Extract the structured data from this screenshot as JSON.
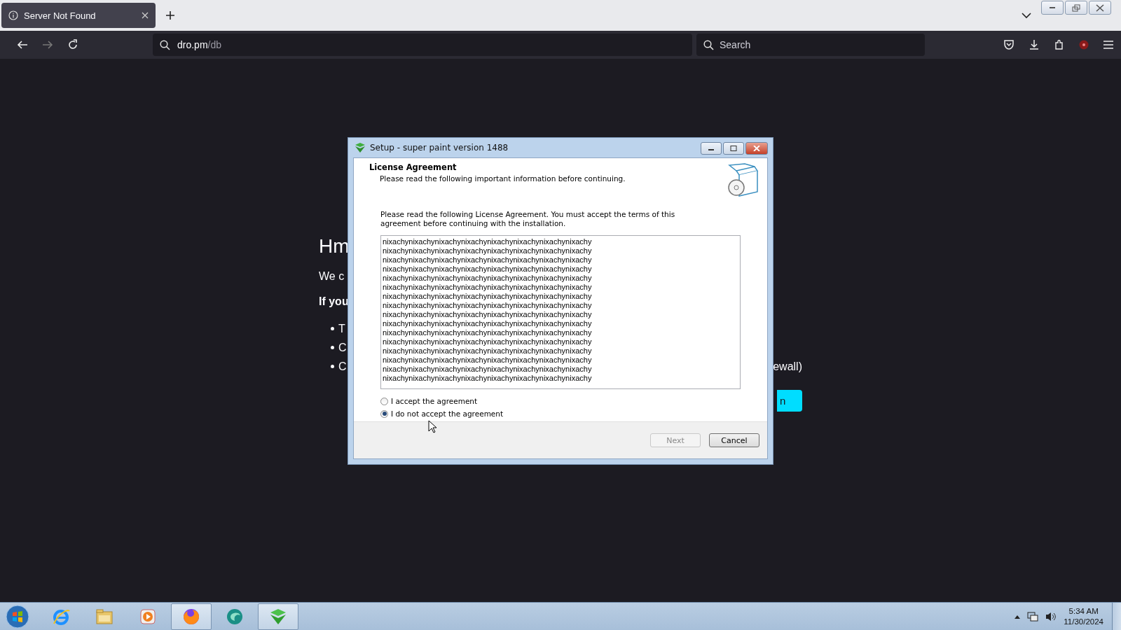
{
  "browser": {
    "tabs": [
      {
        "title": "Server Not Found",
        "selected": true
      }
    ],
    "nav": [
      {
        "kind": "back",
        "disabled": false
      },
      {
        "kind": "forward",
        "disabled": true
      },
      {
        "kind": "reload",
        "disabled": false
      }
    ],
    "url": {
      "host": "dro.pm",
      "path": "/db"
    },
    "search": {
      "placeholder": "Search"
    }
  },
  "page": {
    "heading": "Hm",
    "line_1": "We c",
    "line_2": "If you",
    "bullets": [
      {
        "left": "T"
      },
      {
        "left": "C"
      },
      {
        "left": "C",
        "right": "ewall)"
      }
    ],
    "button": "n"
  },
  "dialog": {
    "title": "Setup - super paint version 1488",
    "heading": "License Agreement",
    "subheading": "Please read the following important information before continuing.",
    "instructions": "Please read the following License Agreement. You must accept the terms of this agreement before continuing with the installation.",
    "license_lines": [
      "nixachynixachynixachynixachynixachynixachynixachynixachy",
      "nixachynixachynixachynixachynixachynixachynixachynixachy",
      "nixachynixachynixachynixachynixachynixachynixachynixachy",
      "nixachynixachynixachynixachynixachynixachynixachynixachy",
      "nixachynixachynixachynixachynixachynixachynixachynixachy",
      "nixachynixachynixachynixachynixachynixachynixachynixachy",
      "nixachynixachynixachynixachynixachynixachynixachynixachy",
      "nixachynixachynixachynixachynixachynixachynixachynixachy",
      "nixachynixachynixachynixachynixachynixachynixachynixachy",
      "nixachynixachynixachynixachynixachynixachynixachynixachy",
      "nixachynixachynixachynixachynixachynixachynixachynixachy",
      "nixachynixachynixachynixachynixachynixachynixachynixachy",
      "nixachynixachynixachynixachynixachynixachynixachynixachy",
      "nixachynixachynixachynixachynixachynixachynixachynixachy",
      "nixachynixachynixachynixachynixachynixachynixachynixachy",
      "nixachynixachynixachynixachynixachynixachynixachynixachy"
    ],
    "options": [
      {
        "label": "I accept the agreement",
        "selected": false
      },
      {
        "label": "I do not accept the agreement",
        "selected": true
      }
    ],
    "buttons": [
      {
        "label": "Next",
        "disabled": true
      },
      {
        "label": "Cancel",
        "disabled": false
      }
    ]
  },
  "taskbar": {
    "apps": [
      {
        "kind": "ie",
        "active": false
      },
      {
        "kind": "folder",
        "active": false
      },
      {
        "kind": "media",
        "active": false
      },
      {
        "kind": "firefox",
        "active": true
      },
      {
        "kind": "teal",
        "active": false
      },
      {
        "kind": "setup",
        "active": true
      }
    ],
    "clock": {
      "time": "5:34 AM",
      "date": "11/30/2024"
    }
  }
}
